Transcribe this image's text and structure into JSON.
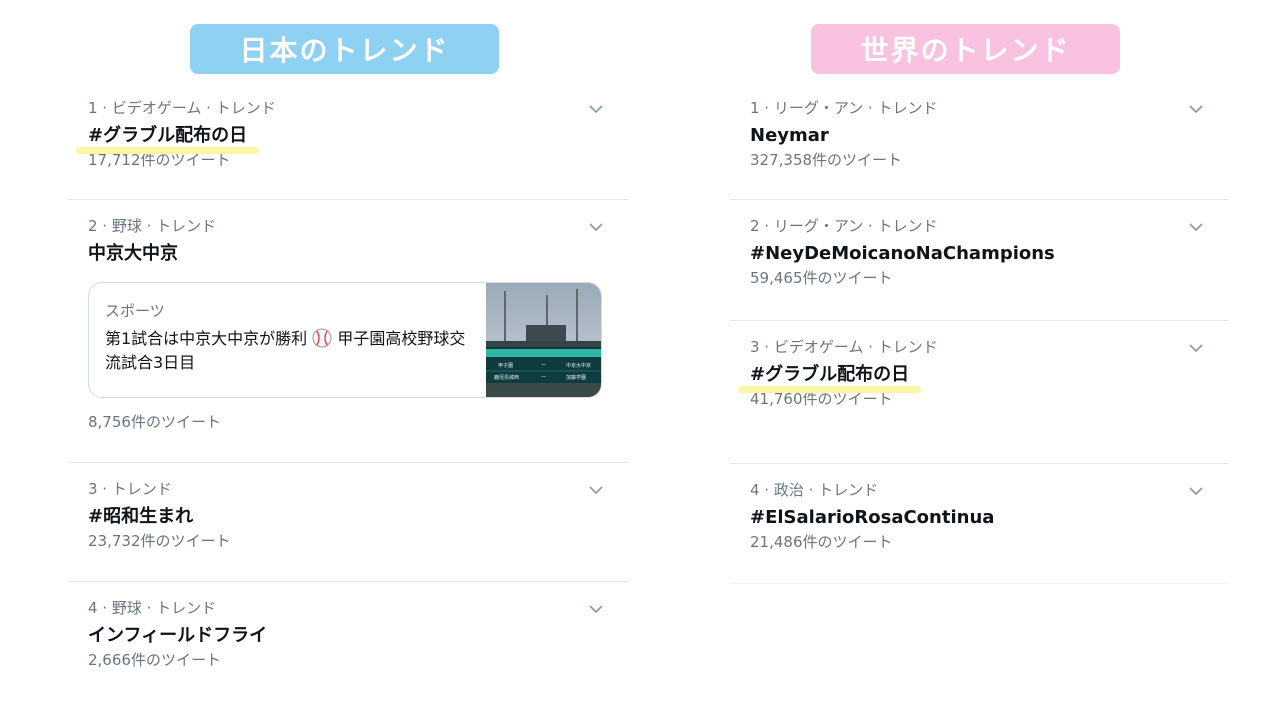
{
  "headers": {
    "japan": {
      "label": "日本のトレンド",
      "color": "#8ed1f2"
    },
    "world": {
      "label": "世界のトレンド",
      "color": "#f8c2e0"
    }
  },
  "highlight_color": "#fbf6a5",
  "japan_trends": [
    {
      "meta": "1 · ビデオゲーム · トレンド",
      "title": "#グラブル配布の日",
      "count": "17,712件のツイート",
      "highlighted": true
    },
    {
      "meta": "2 · 野球 · トレンド",
      "title": "中京大中京",
      "count": "8,756件のツイート",
      "card": {
        "category": "スポーツ",
        "headline_part1": "第1試合は中京大中京が勝利",
        "headline_part2": "甲子園高校野球交流試合3日目"
      }
    },
    {
      "meta": "3 · トレンド",
      "title": "#昭和生まれ",
      "count": "23,732件のツイート"
    },
    {
      "meta": "4 · 野球 · トレンド",
      "title": "インフィールドフライ",
      "count": "2,666件のツイート"
    }
  ],
  "world_trends": [
    {
      "meta": "1 · リーグ・アン · トレンド",
      "title": "Neymar",
      "count": "327,358件のツイート"
    },
    {
      "meta": "2 · リーグ・アン · トレンド",
      "title": "#NeyDeMoicanoNaChampions",
      "count": "59,465件のツイート"
    },
    {
      "meta": "3 · ビデオゲーム · トレンド",
      "title": "#グラブル配布の日",
      "count": "41,760件のツイート",
      "highlighted": true
    },
    {
      "meta": "4 · 政治 · トレンド",
      "title": "#ElSalarioRosaContinua",
      "count": "21,486件のツイート"
    }
  ],
  "icons": {
    "chevron": "chevron-down-icon",
    "baseball": "baseball-emoji-icon"
  },
  "scoreboard_image": {
    "rows": [
      [
        "甲子園",
        "一",
        "中京大中京"
      ],
      [
        "鹿児島城西",
        "一",
        "加藤学園"
      ]
    ]
  }
}
